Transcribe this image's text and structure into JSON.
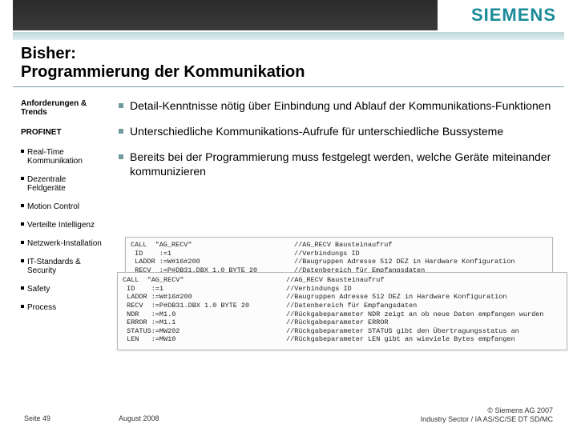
{
  "header": {
    "logo_text": "SIEMENS",
    "title_line1": "Bisher:",
    "title_line2": "Programmierung der Kommunikation"
  },
  "sidebar": {
    "head1": "Anforderungen & Trends",
    "head2": "PROFINET",
    "items": [
      "Real-Time Kommunikation",
      "Dezentrale Feldgeräte",
      "Motion Control",
      "Verteilte Intelligenz",
      "Netzwerk-Installation",
      "IT-Standards & Security",
      "Safety",
      "Process"
    ]
  },
  "main": {
    "bullets": [
      "Detail-Kenntnisse nötig über Einbindung und Ablauf der Kommunikations-Funktionen",
      "Unterschiedliche Kommunikations-Aufrufe für unterschiedliche Bussysteme",
      "Bereits bei der Programmierung muss festgelegt werden, welche Geräte miteinander kommunizieren"
    ]
  },
  "code": {
    "box1": "CALL  \"AG_RECV\"                         //AG_RECV Bausteinaufruf\n ID    :=1                              //Verbindungs ID\n LADDR :=W#16#200                       //Baugruppen Adresse 512 DEZ in Hardware Konfiguration\n RECV  :=P#DB31.DBX 1.0 BYTE 20         //Datenbereich für Empfangsdaten",
    "box2": "CALL  \"AG_RECV\"                         //AG_RECV Bausteinaufruf\n ID    :=1                              //Verbindungs ID\n LADDR :=W#16#200                       //Baugruppen Adresse 512 DEZ in Hardware Konfiguration\n RECV  :=P#DB31.DBX 1.0 BYTE 20         //Datenbereich für Empfangsdaten\n NDR   :=M1.0                           //Rückgabeparameter NDR zeigt an ob neue Daten empfangen wurden\n ERROR :=M1.1                           //Rückgabeparameter ERROR\n STATUS:=MW202                          //Rückgabeparameter STATUS gibt den Übertragungsstatus an\n LEN   :=MW10                           //Rückgabeparameter LEN gibt an wieviele Bytes empfangen"
  },
  "footer": {
    "page": "Seite 49",
    "date": "August 2008",
    "copyright": "© Siemens AG 2007",
    "org": "Industry Sector / IA AS/SC/SE DT SD/MC"
  }
}
